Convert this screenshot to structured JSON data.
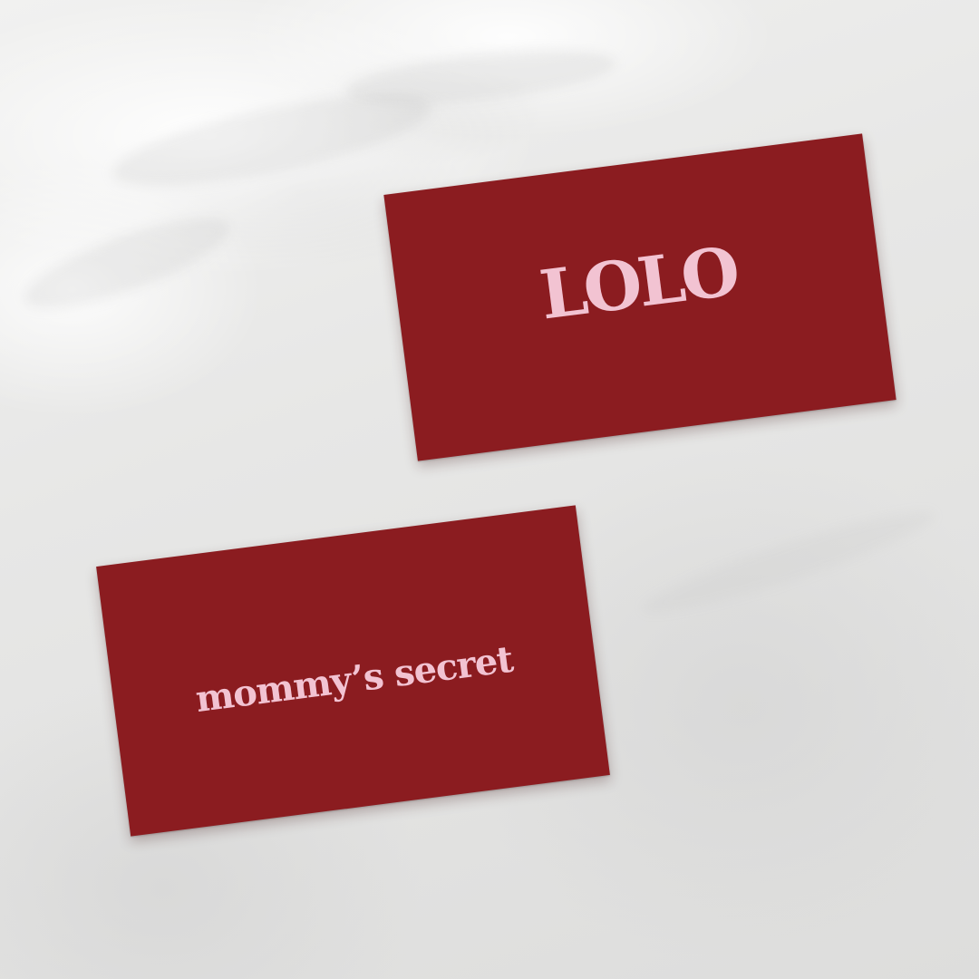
{
  "cards": {
    "front": {
      "logo_text": "LOLO",
      "background_color": "#8b1c20",
      "text_color": "#f2c3d2"
    },
    "back": {
      "tagline_text": "mommy’s secret",
      "background_color": "#8b1c20",
      "text_color": "#f2c3d2"
    }
  },
  "surface": {
    "material": "white marble",
    "color": "#e6e6e5"
  }
}
